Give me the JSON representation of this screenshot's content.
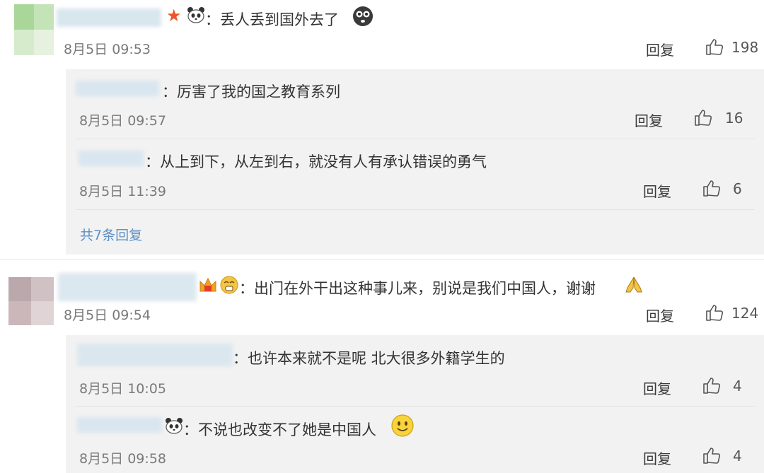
{
  "comments": [
    {
      "text": "：丢人丢到国外去了",
      "time": "8月5日 09:53",
      "reply_label": "回复",
      "likes": "198",
      "replies": [
        {
          "text": "：厉害了我的国之教育系列",
          "time": "8月5日 09:57",
          "reply_label": "回复",
          "likes": "16"
        },
        {
          "text": "：从上到下，从左到右，就没有人有承认错误的勇气",
          "time": "8月5日 11:39",
          "reply_label": "回复",
          "likes": "6"
        }
      ],
      "more_replies": "共7条回复"
    },
    {
      "text": "：出门在外干出这种事儿来，别说是我们中国人，谢谢",
      "time": "8月5日 09:54",
      "reply_label": "回复",
      "likes": "124",
      "replies": [
        {
          "text": "：也许本来就不是呢  北大很多外籍学生的",
          "time": "8月5日 10:05",
          "reply_label": "回复",
          "likes": "4"
        },
        {
          "text": "：不说也改变不了她是中国人",
          "time": "8月5日 09:58",
          "reply_label": "回复",
          "likes": "4"
        }
      ]
    }
  ]
}
